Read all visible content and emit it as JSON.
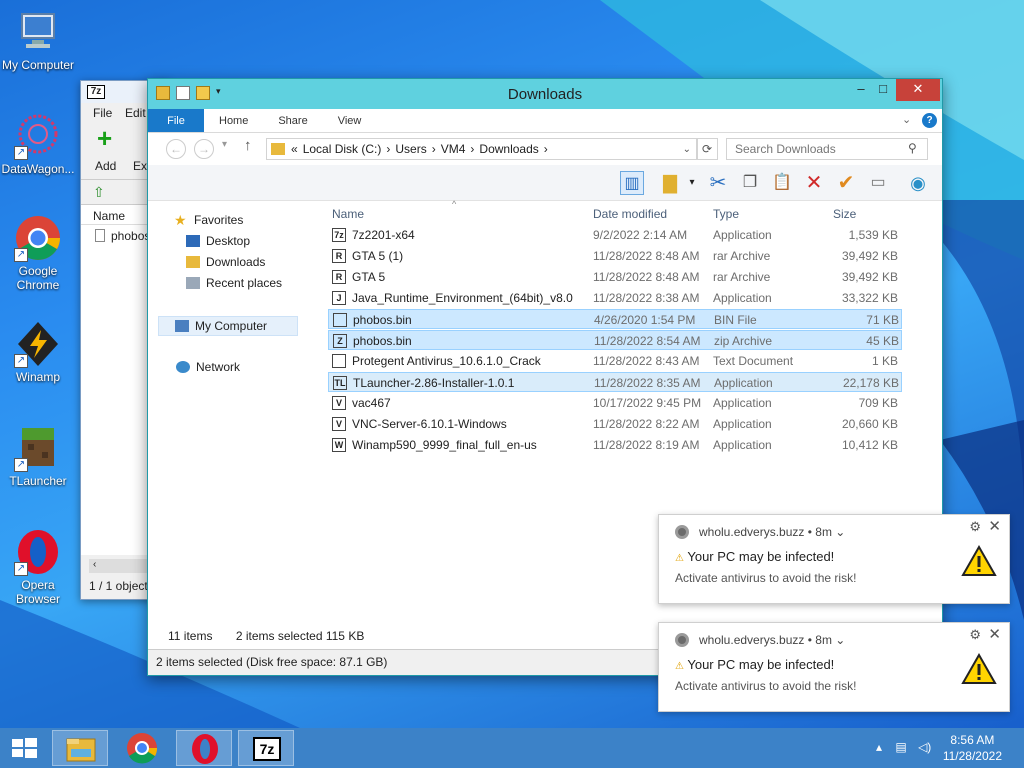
{
  "desktop": {
    "icons": [
      {
        "label": "My Computer"
      },
      {
        "label": "DataWagon..."
      },
      {
        "label": "Google Chrome"
      },
      {
        "label": "Winamp"
      },
      {
        "label": "TLauncher"
      },
      {
        "label": "Opera Browser"
      }
    ]
  },
  "sevenzip": {
    "logo": "7z",
    "menu_file": "File",
    "menu_edit": "Edit",
    "add_label": "Add",
    "ext_label": "Ext",
    "col_name": "Name",
    "item": "phobos",
    "status": "1 / 1 object"
  },
  "explorer": {
    "title": "Downloads",
    "tabs": [
      "File",
      "Home",
      "Share",
      "View"
    ],
    "address": [
      "«",
      "Local Disk (C:)",
      "Users",
      "VM4",
      "Downloads"
    ],
    "search_placeholder": "Search Downloads",
    "nav": {
      "favorites": "Favorites",
      "desktop": "Desktop",
      "downloads": "Downloads",
      "recent": "Recent places",
      "computer": "My Computer",
      "network": "Network"
    },
    "columns": {
      "name": "Name",
      "date": "Date modified",
      "type": "Type",
      "size": "Size"
    },
    "files": [
      {
        "name": "7z2201-x64",
        "date": "9/2/2022 2:14 AM",
        "type": "Application",
        "size": "1,539 KB",
        "icon": "7z"
      },
      {
        "name": "GTA 5 (1)",
        "date": "11/28/2022 8:48 AM",
        "type": "rar Archive",
        "size": "39,492 KB",
        "icon": "R"
      },
      {
        "name": "GTA 5",
        "date": "11/28/2022 8:48 AM",
        "type": "rar Archive",
        "size": "39,492 KB",
        "icon": "R"
      },
      {
        "name": "Java_Runtime_Environment_(64bit)_v8.0",
        "date": "11/28/2022 8:38 AM",
        "type": "Application",
        "size": "33,322 KB",
        "icon": "J"
      },
      {
        "name": "phobos.bin",
        "date": "4/26/2020 1:54 PM",
        "type": "BIN File",
        "size": "71 KB",
        "icon": ""
      },
      {
        "name": "phobos.bin",
        "date": "11/28/2022 8:54 AM",
        "type": "zip Archive",
        "size": "45 KB",
        "icon": "Z"
      },
      {
        "name": "Protegent Antivirus_10.6.1.0_Crack",
        "date": "11/28/2022 8:43 AM",
        "type": "Text Document",
        "size": "1 KB",
        "icon": ""
      },
      {
        "name": "TLauncher-2.86-Installer-1.0.1",
        "date": "11/28/2022 8:35 AM",
        "type": "Application",
        "size": "22,178 KB",
        "icon": "TL"
      },
      {
        "name": "vac467",
        "date": "10/17/2022 9:45 PM",
        "type": "Application",
        "size": "709 KB",
        "icon": "V"
      },
      {
        "name": "VNC-Server-6.10.1-Windows",
        "date": "11/28/2022 8:22 AM",
        "type": "Application",
        "size": "20,660 KB",
        "icon": "V"
      },
      {
        "name": "Winamp590_9999_final_full_en-us",
        "date": "11/28/2022 8:19 AM",
        "type": "Application",
        "size": "10,412 KB",
        "icon": "W"
      }
    ],
    "item_count": "11 items",
    "selected_info": "2 items selected  115 KB",
    "status_bar": "2 items selected (Disk free space: 87.1 GB)"
  },
  "notifications": [
    {
      "source": "wholu.edverys.buzz",
      "age": "8m",
      "title": "Your PC may be infected!",
      "message": "Activate antivirus to avoid the risk!"
    },
    {
      "source": "wholu.edverys.buzz",
      "age": "8m",
      "title": "Your PC may be infected!",
      "message": "Activate antivirus to avoid the risk!"
    }
  ],
  "taskbar": {
    "time": "8:56 AM",
    "date": "11/28/2022",
    "sevenzip_label": "7z"
  }
}
